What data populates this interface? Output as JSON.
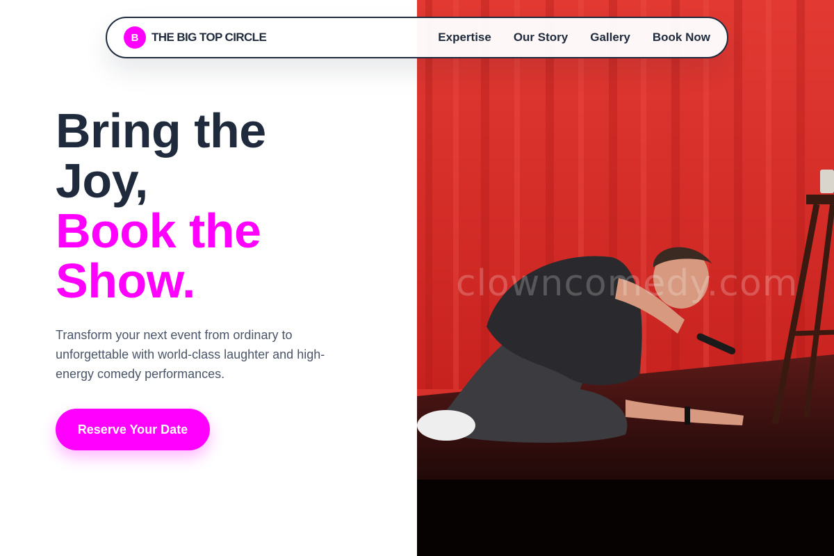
{
  "brand": {
    "mark": "B",
    "name": "THE BIG TOP CIRCLE"
  },
  "nav": {
    "links": [
      {
        "label": "Expertise"
      },
      {
        "label": "Our Story"
      },
      {
        "label": "Gallery"
      },
      {
        "label": "Book Now"
      }
    ]
  },
  "hero": {
    "headline_line1": "Bring the",
    "headline_line2": "Joy,",
    "headline_line3": "Book the",
    "headline_line4": "Show.",
    "subtitle": "Transform your next event from ordinary to unforgettable with world-class laughter and high-energy comedy performances.",
    "cta_label": "Reserve Your Date"
  },
  "photo": {
    "watermark": "clowncomedy.com",
    "description_icon": "performer-photo"
  },
  "colors": {
    "accent": "#ff00ff",
    "text_dark": "#1f2a3c",
    "text_muted": "#4a5568",
    "curtain": "#d8302b"
  }
}
